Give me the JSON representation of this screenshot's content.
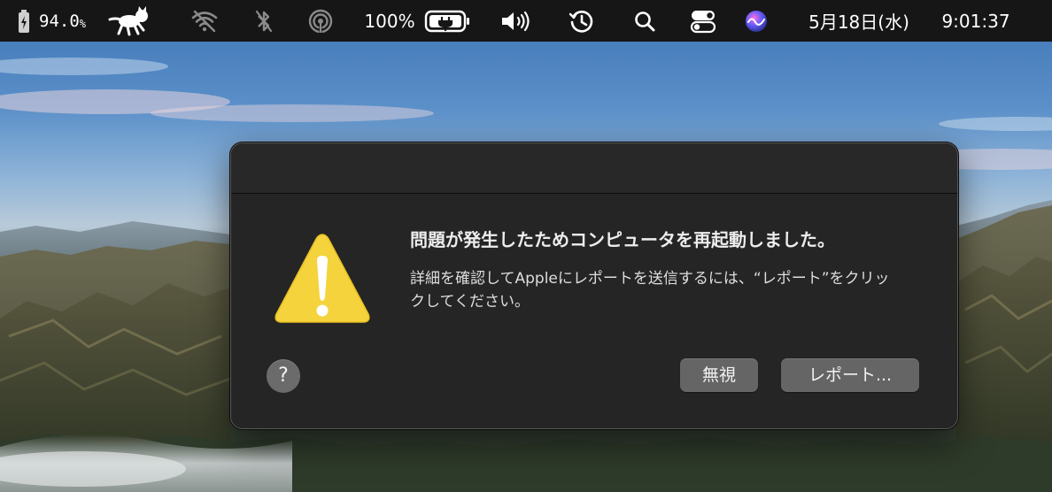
{
  "menubar": {
    "battery_level": "94.0",
    "battery_unit": "%",
    "battery_percent": "100%",
    "date": "5月18日(水)",
    "time": "9:01:37",
    "icons": [
      "battery-charging-icon",
      "runcat-icon",
      "wifi-off-icon",
      "bluetooth-off-icon",
      "airdrop-icon",
      "battery-icon",
      "volume-icon",
      "time-machine-icon",
      "spotlight-icon",
      "control-center-icon",
      "siri-icon"
    ]
  },
  "dialog": {
    "title": "問題が発生したためコンピュータを再起動しました。",
    "message": "詳細を確認してAppleにレポートを送信するには、“レポート”をクリックしてください。",
    "help_label": "?",
    "ignore_label": "無視",
    "report_label": "レポート...",
    "icon": "warning-icon"
  },
  "colors": {
    "dialog_background": "#252525",
    "button_background": "#656565",
    "warning_yellow": "#f5d33d",
    "menubar_background": "#161616"
  }
}
